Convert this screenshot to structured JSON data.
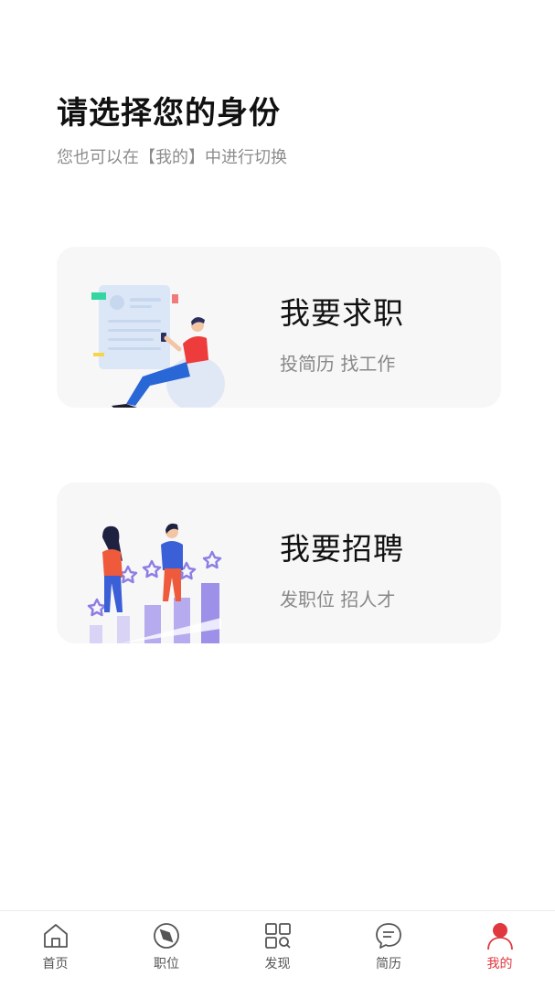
{
  "header": {
    "title": "请选择您的身份",
    "subtitle": "您也可以在【我的】中进行切换"
  },
  "cards": [
    {
      "title": "我要求职",
      "desc": "投简历 找工作"
    },
    {
      "title": "我要招聘",
      "desc": "发职位 招人才"
    }
  ],
  "tabbar": {
    "items": [
      {
        "label": "首页",
        "icon": "home-icon"
      },
      {
        "label": "职位",
        "icon": "compass-icon"
      },
      {
        "label": "发现",
        "icon": "discover-grid-icon"
      },
      {
        "label": "简历",
        "icon": "chat-bubble-icon"
      },
      {
        "label": "我的",
        "icon": "person-icon"
      }
    ],
    "active_index": 4,
    "active_color": "#e0383e",
    "inactive_color": "#555555"
  }
}
